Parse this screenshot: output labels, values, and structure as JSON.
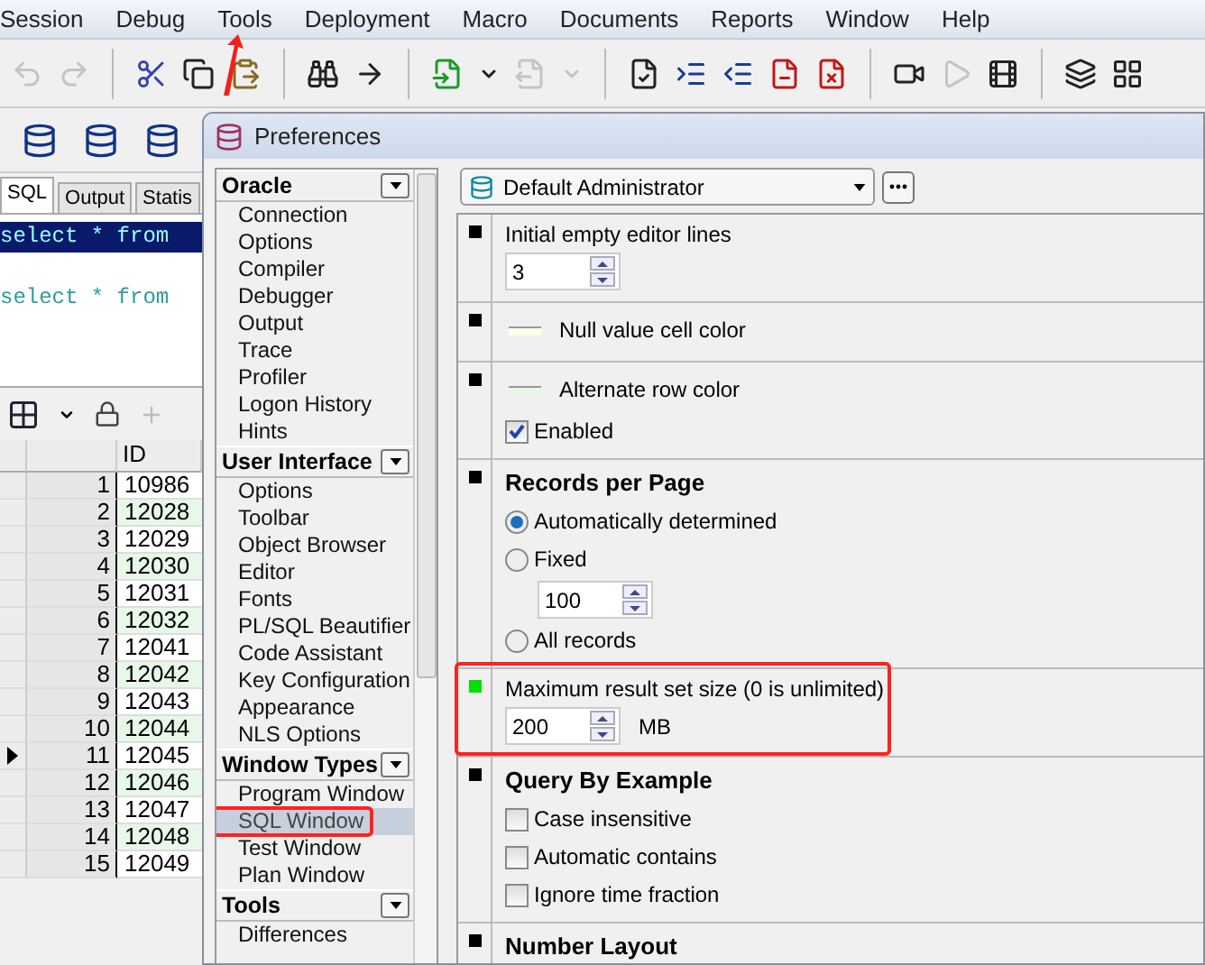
{
  "menu": [
    {
      "label": "Session"
    },
    {
      "label": "Debug"
    },
    {
      "label": "Tools",
      "pointed": true
    },
    {
      "label": "Deployment"
    },
    {
      "label": "Macro"
    },
    {
      "label": "Documents"
    },
    {
      "label": "Reports"
    },
    {
      "label": "Window"
    },
    {
      "label": "Help"
    }
  ],
  "toolbar": [
    {
      "kind": "undo",
      "disabled": true
    },
    {
      "kind": "redo",
      "disabled": true
    },
    {
      "kind": "sep"
    },
    {
      "kind": "cut",
      "disabled": false
    },
    {
      "kind": "copy",
      "disabled": false
    },
    {
      "kind": "paste",
      "disabled": false
    },
    {
      "kind": "sep"
    },
    {
      "kind": "find",
      "disabled": false
    },
    {
      "kind": "find-next",
      "disabled": false
    },
    {
      "kind": "sep"
    },
    {
      "kind": "import",
      "disabled": false
    },
    {
      "kind": "caret",
      "disabled": false
    },
    {
      "kind": "export",
      "disabled": true
    },
    {
      "kind": "caret",
      "disabled": true
    },
    {
      "kind": "sep"
    },
    {
      "kind": "check",
      "disabled": false
    },
    {
      "kind": "indent",
      "disabled": false
    },
    {
      "kind": "outdent",
      "disabled": false
    },
    {
      "kind": "doc-out",
      "disabled": false
    },
    {
      "kind": "doc-in",
      "disabled": false
    },
    {
      "kind": "sep"
    },
    {
      "kind": "record",
      "disabled": false
    },
    {
      "kind": "play",
      "disabled": true
    },
    {
      "kind": "macro",
      "disabled": false
    },
    {
      "kind": "sep"
    },
    {
      "kind": "windows",
      "disabled": false
    },
    {
      "kind": "grid",
      "disabled": false
    }
  ],
  "sql_window": {
    "tabs": [
      {
        "label": "SQL",
        "selected": true
      },
      {
        "label": "Output",
        "selected": false
      },
      {
        "label": "Statis",
        "selected": false
      }
    ],
    "lines": [
      {
        "text": "select * from",
        "selected": true
      },
      {
        "text": "select * from",
        "selected": false
      }
    ],
    "grid": {
      "columns": [
        "ID"
      ],
      "rows": [
        {
          "num": "1",
          "id": "10986",
          "current": false
        },
        {
          "num": "2",
          "id": "12028",
          "current": false
        },
        {
          "num": "3",
          "id": "12029",
          "current": false
        },
        {
          "num": "4",
          "id": "12030",
          "current": false
        },
        {
          "num": "5",
          "id": "12031",
          "current": false
        },
        {
          "num": "6",
          "id": "12032",
          "current": false
        },
        {
          "num": "7",
          "id": "12041",
          "current": false
        },
        {
          "num": "8",
          "id": "12042",
          "current": false
        },
        {
          "num": "9",
          "id": "12043",
          "current": false
        },
        {
          "num": "10",
          "id": "12044",
          "current": false
        },
        {
          "num": "11",
          "id": "12045",
          "current": true
        },
        {
          "num": "12",
          "id": "12046",
          "current": false
        },
        {
          "num": "13",
          "id": "12047",
          "current": false
        },
        {
          "num": "14",
          "id": "12048",
          "current": false
        },
        {
          "num": "15",
          "id": "12049",
          "current": false
        }
      ]
    }
  },
  "dialog": {
    "title": "Preferences",
    "tree": [
      {
        "label": "Oracle",
        "items": [
          {
            "label": "Connection",
            "selected": false,
            "highlighted": false
          },
          {
            "label": "Options",
            "selected": false,
            "highlighted": false
          },
          {
            "label": "Compiler",
            "selected": false,
            "highlighted": false
          },
          {
            "label": "Debugger",
            "selected": false,
            "highlighted": false
          },
          {
            "label": "Output",
            "selected": false,
            "highlighted": false
          },
          {
            "label": "Trace",
            "selected": false,
            "highlighted": false
          },
          {
            "label": "Profiler",
            "selected": false,
            "highlighted": false
          },
          {
            "label": "Logon History",
            "selected": false,
            "highlighted": false
          },
          {
            "label": "Hints",
            "selected": false,
            "highlighted": false
          }
        ]
      },
      {
        "label": "User Interface",
        "items": [
          {
            "label": "Options",
            "selected": false,
            "highlighted": false
          },
          {
            "label": "Toolbar",
            "selected": false,
            "highlighted": false
          },
          {
            "label": "Object Browser",
            "selected": false,
            "highlighted": false
          },
          {
            "label": "Editor",
            "selected": false,
            "highlighted": false
          },
          {
            "label": "Fonts",
            "selected": false,
            "highlighted": false
          },
          {
            "label": "PL/SQL Beautifier",
            "selected": false,
            "highlighted": false
          },
          {
            "label": "Code Assistant",
            "selected": false,
            "highlighted": false
          },
          {
            "label": "Key Configuration",
            "selected": false,
            "highlighted": false
          },
          {
            "label": "Appearance",
            "selected": false,
            "highlighted": false
          },
          {
            "label": "NLS Options",
            "selected": false,
            "highlighted": false
          }
        ]
      },
      {
        "label": "Window Types",
        "items": [
          {
            "label": "Program Window",
            "selected": false,
            "highlighted": false
          },
          {
            "label": "SQL Window",
            "selected": true,
            "highlighted": true
          },
          {
            "label": "Test Window",
            "selected": false,
            "highlighted": false
          },
          {
            "label": "Plan Window",
            "selected": false,
            "highlighted": false
          }
        ]
      },
      {
        "label": "Tools",
        "items": [
          {
            "label": "Differences",
            "selected": false,
            "highlighted": false
          }
        ]
      }
    ],
    "profile": "Default Administrator",
    "sections": [
      {
        "kind": "setting",
        "modified": false,
        "highlighted": false,
        "title": "Initial empty editor lines",
        "items": [
          {
            "kind": "spinner",
            "value": "3"
          }
        ]
      },
      {
        "kind": "setting",
        "modified": false,
        "highlighted": false,
        "items": [
          {
            "kind": "swatch",
            "label": "Null value cell color",
            "color": "#ffffe8"
          }
        ]
      },
      {
        "kind": "setting",
        "modified": false,
        "highlighted": false,
        "items": [
          {
            "kind": "swatch",
            "label": "Alternate row color",
            "color": "#e8f8e8"
          },
          {
            "kind": "checkbox",
            "label": "Enabled",
            "checked": true
          }
        ]
      },
      {
        "kind": "group",
        "modified": false,
        "highlighted": false,
        "title": "Records per Page",
        "items": [
          {
            "kind": "radio",
            "label": "Automatically determined",
            "selected": true
          },
          {
            "kind": "radio",
            "label": "Fixed",
            "selected": false,
            "children": [
              {
                "kind": "spinner",
                "value": "100"
              }
            ]
          },
          {
            "kind": "radio",
            "label": "All records",
            "selected": false
          }
        ]
      },
      {
        "kind": "setting",
        "modified": true,
        "highlighted": true,
        "title": "Maximum result set size (0 is unlimited)",
        "items": [
          {
            "kind": "spinner",
            "value": "200",
            "unit": "MB"
          }
        ]
      },
      {
        "kind": "group",
        "modified": false,
        "highlighted": false,
        "title": "Query By Example",
        "items": [
          {
            "kind": "checkbox",
            "label": "Case insensitive",
            "checked": false
          },
          {
            "kind": "checkbox",
            "label": "Automatic contains",
            "checked": false
          },
          {
            "kind": "checkbox",
            "label": "Ignore time fraction",
            "checked": false
          }
        ]
      },
      {
        "kind": "group",
        "modified": false,
        "highlighted": false,
        "title": "Number Layout"
      }
    ]
  }
}
